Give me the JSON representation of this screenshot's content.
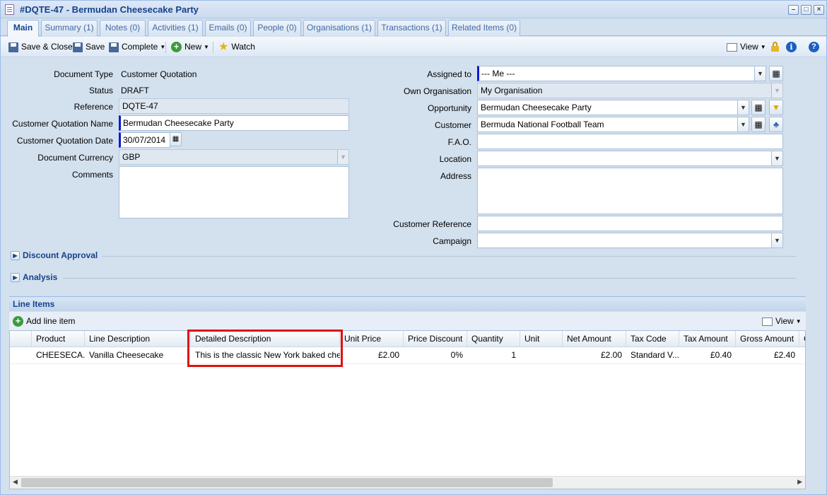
{
  "window": {
    "title": "#DQTE-47 - Bermudan Cheesecake Party"
  },
  "tabs": [
    {
      "label": "Main"
    },
    {
      "label": "Summary (1)"
    },
    {
      "label": "Notes (0)"
    },
    {
      "label": "Activities (1)"
    },
    {
      "label": "Emails (0)"
    },
    {
      "label": "People (0)"
    },
    {
      "label": "Organisations (1)"
    },
    {
      "label": "Transactions (1)"
    },
    {
      "label": "Related Items (0)"
    }
  ],
  "toolbar": {
    "save_close": "Save & Close",
    "save": "Save",
    "complete": "Complete",
    "new": "New",
    "watch": "Watch",
    "view": "View"
  },
  "form": {
    "document_type": {
      "label": "Document Type",
      "value": "Customer Quotation"
    },
    "status": {
      "label": "Status",
      "value": "DRAFT"
    },
    "reference": {
      "label": "Reference",
      "value": "DQTE-47"
    },
    "quotation_name": {
      "label": "Customer Quotation Name",
      "value": "Bermudan Cheesecake Party"
    },
    "quotation_date": {
      "label": "Customer Quotation Date",
      "value": "30/07/2014"
    },
    "currency": {
      "label": "Document Currency",
      "value": "GBP"
    },
    "comments": {
      "label": "Comments",
      "value": ""
    },
    "assigned_to": {
      "label": "Assigned to",
      "value": "--- Me ---"
    },
    "own_org": {
      "label": "Own Organisation",
      "value": "My Organisation"
    },
    "opportunity": {
      "label": "Opportunity",
      "value": "Bermudan Cheesecake Party"
    },
    "customer": {
      "label": "Customer",
      "value": "Bermuda National Football Team"
    },
    "fao": {
      "label": "F.A.O.",
      "value": ""
    },
    "location": {
      "label": "Location",
      "value": ""
    },
    "address": {
      "label": "Address",
      "value": ""
    },
    "customer_reference": {
      "label": "Customer Reference",
      "value": ""
    },
    "campaign": {
      "label": "Campaign",
      "value": ""
    }
  },
  "sections": {
    "discount": "Discount Approval",
    "analysis": "Analysis",
    "line_items": "Line Items"
  },
  "line_items": {
    "add_label": "Add line item",
    "view_label": "View",
    "columns": [
      "Product",
      "Line Description",
      "Detailed Description",
      "Unit Price",
      "Price Discount",
      "Quantity",
      "Unit",
      "Net Amount",
      "Tax Code",
      "Tax Amount",
      "Gross Amount",
      "C"
    ],
    "rows": [
      [
        "CHEESECA...",
        "Vanilla Cheesecake",
        "This is the classic New York baked che...",
        "£2.00",
        "0%",
        "1",
        "",
        "£2.00",
        "Standard V...",
        "£0.40",
        "£2.40",
        ""
      ]
    ]
  }
}
